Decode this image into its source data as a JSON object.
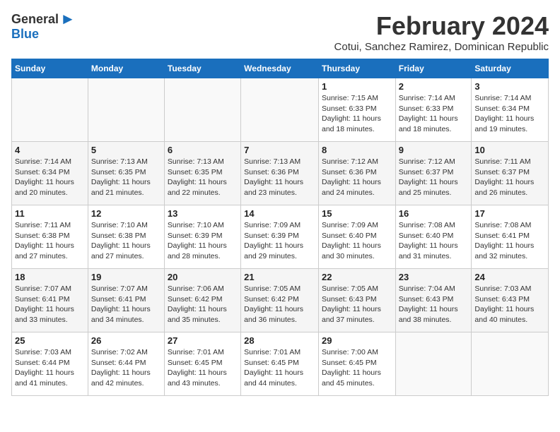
{
  "header": {
    "logo_line1": "General",
    "logo_line2": "Blue",
    "month_year": "February 2024",
    "location": "Cotui, Sanchez Ramirez, Dominican Republic"
  },
  "days_of_week": [
    "Sunday",
    "Monday",
    "Tuesday",
    "Wednesday",
    "Thursday",
    "Friday",
    "Saturday"
  ],
  "weeks": [
    [
      {
        "day": "",
        "info": ""
      },
      {
        "day": "",
        "info": ""
      },
      {
        "day": "",
        "info": ""
      },
      {
        "day": "",
        "info": ""
      },
      {
        "day": "1",
        "info": "Sunrise: 7:15 AM\nSunset: 6:33 PM\nDaylight: 11 hours and 18 minutes."
      },
      {
        "day": "2",
        "info": "Sunrise: 7:14 AM\nSunset: 6:33 PM\nDaylight: 11 hours and 18 minutes."
      },
      {
        "day": "3",
        "info": "Sunrise: 7:14 AM\nSunset: 6:34 PM\nDaylight: 11 hours and 19 minutes."
      }
    ],
    [
      {
        "day": "4",
        "info": "Sunrise: 7:14 AM\nSunset: 6:34 PM\nDaylight: 11 hours and 20 minutes."
      },
      {
        "day": "5",
        "info": "Sunrise: 7:13 AM\nSunset: 6:35 PM\nDaylight: 11 hours and 21 minutes."
      },
      {
        "day": "6",
        "info": "Sunrise: 7:13 AM\nSunset: 6:35 PM\nDaylight: 11 hours and 22 minutes."
      },
      {
        "day": "7",
        "info": "Sunrise: 7:13 AM\nSunset: 6:36 PM\nDaylight: 11 hours and 23 minutes."
      },
      {
        "day": "8",
        "info": "Sunrise: 7:12 AM\nSunset: 6:36 PM\nDaylight: 11 hours and 24 minutes."
      },
      {
        "day": "9",
        "info": "Sunrise: 7:12 AM\nSunset: 6:37 PM\nDaylight: 11 hours and 25 minutes."
      },
      {
        "day": "10",
        "info": "Sunrise: 7:11 AM\nSunset: 6:37 PM\nDaylight: 11 hours and 26 minutes."
      }
    ],
    [
      {
        "day": "11",
        "info": "Sunrise: 7:11 AM\nSunset: 6:38 PM\nDaylight: 11 hours and 27 minutes."
      },
      {
        "day": "12",
        "info": "Sunrise: 7:10 AM\nSunset: 6:38 PM\nDaylight: 11 hours and 27 minutes."
      },
      {
        "day": "13",
        "info": "Sunrise: 7:10 AM\nSunset: 6:39 PM\nDaylight: 11 hours and 28 minutes."
      },
      {
        "day": "14",
        "info": "Sunrise: 7:09 AM\nSunset: 6:39 PM\nDaylight: 11 hours and 29 minutes."
      },
      {
        "day": "15",
        "info": "Sunrise: 7:09 AM\nSunset: 6:40 PM\nDaylight: 11 hours and 30 minutes."
      },
      {
        "day": "16",
        "info": "Sunrise: 7:08 AM\nSunset: 6:40 PM\nDaylight: 11 hours and 31 minutes."
      },
      {
        "day": "17",
        "info": "Sunrise: 7:08 AM\nSunset: 6:41 PM\nDaylight: 11 hours and 32 minutes."
      }
    ],
    [
      {
        "day": "18",
        "info": "Sunrise: 7:07 AM\nSunset: 6:41 PM\nDaylight: 11 hours and 33 minutes."
      },
      {
        "day": "19",
        "info": "Sunrise: 7:07 AM\nSunset: 6:41 PM\nDaylight: 11 hours and 34 minutes."
      },
      {
        "day": "20",
        "info": "Sunrise: 7:06 AM\nSunset: 6:42 PM\nDaylight: 11 hours and 35 minutes."
      },
      {
        "day": "21",
        "info": "Sunrise: 7:05 AM\nSunset: 6:42 PM\nDaylight: 11 hours and 36 minutes."
      },
      {
        "day": "22",
        "info": "Sunrise: 7:05 AM\nSunset: 6:43 PM\nDaylight: 11 hours and 37 minutes."
      },
      {
        "day": "23",
        "info": "Sunrise: 7:04 AM\nSunset: 6:43 PM\nDaylight: 11 hours and 38 minutes."
      },
      {
        "day": "24",
        "info": "Sunrise: 7:03 AM\nSunset: 6:43 PM\nDaylight: 11 hours and 40 minutes."
      }
    ],
    [
      {
        "day": "25",
        "info": "Sunrise: 7:03 AM\nSunset: 6:44 PM\nDaylight: 11 hours and 41 minutes."
      },
      {
        "day": "26",
        "info": "Sunrise: 7:02 AM\nSunset: 6:44 PM\nDaylight: 11 hours and 42 minutes."
      },
      {
        "day": "27",
        "info": "Sunrise: 7:01 AM\nSunset: 6:45 PM\nDaylight: 11 hours and 43 minutes."
      },
      {
        "day": "28",
        "info": "Sunrise: 7:01 AM\nSunset: 6:45 PM\nDaylight: 11 hours and 44 minutes."
      },
      {
        "day": "29",
        "info": "Sunrise: 7:00 AM\nSunset: 6:45 PM\nDaylight: 11 hours and 45 minutes."
      },
      {
        "day": "",
        "info": ""
      },
      {
        "day": "",
        "info": ""
      }
    ]
  ]
}
